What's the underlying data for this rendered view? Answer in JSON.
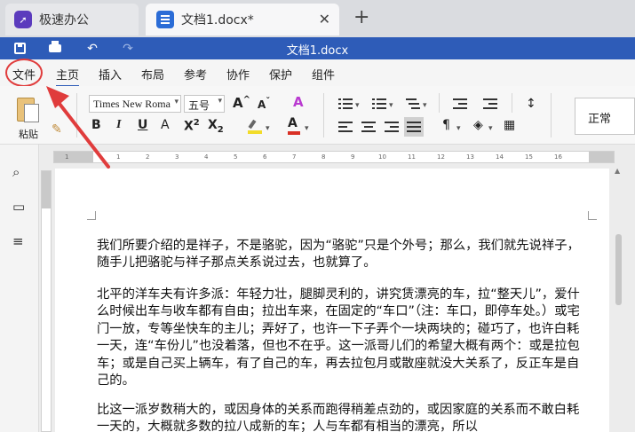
{
  "tabs": {
    "home": {
      "label": "极速办公"
    },
    "doc": {
      "label": "文档1.docx*",
      "close": "✕"
    },
    "new_tab": "+"
  },
  "titlebar": {
    "title": "文档1.docx"
  },
  "menu": {
    "items": [
      "文件",
      "主页",
      "插入",
      "布局",
      "参考",
      "协作",
      "保护",
      "组件"
    ],
    "active": "主页"
  },
  "ribbon": {
    "paste_label": "粘贴",
    "font_name": "Times New Roma",
    "font_size": "五号",
    "style_name": "正常"
  },
  "ruler": {
    "ticks": [
      "1",
      "1",
      "2",
      "3",
      "4",
      "5",
      "6",
      "7",
      "8",
      "9",
      "10",
      "11",
      "12",
      "13",
      "14",
      "15",
      "16"
    ]
  },
  "document": {
    "paragraphs": [
      "我们所要介绍的是祥子，不是骆驼，因为“骆驼”只是个外号；那么，我们就先说祥子，随手儿把骆驼与祥子那点关系说过去，也就算了。",
      "北平的洋车夫有许多派：年轻力壮，腿脚灵利的，讲究赁漂亮的车，拉“整天儿”，爱什么时候出车与收车都有自由；拉出车来，在固定的“车口”（注：车口，即停车处。）或宅门一放，专等坐快车的主儿；弄好了，也许一下子弄个一块两块的；碰巧了，也许白耗一天，连“车份儿”也没着落，但也不在乎。这一派哥儿们的希望大概有两个：或是拉包车；或是自己买上辆车，有了自己的车，再去拉包月或散座就没大关系了，反正车是自己的。",
      "比这一派岁数稍大的，或因身体的关系而跑得稍差点劲的，或因家庭的关系而不敢白耗一天的，大概就多数的拉八成新的车；人与车都有相当的漂亮，所以"
    ]
  }
}
